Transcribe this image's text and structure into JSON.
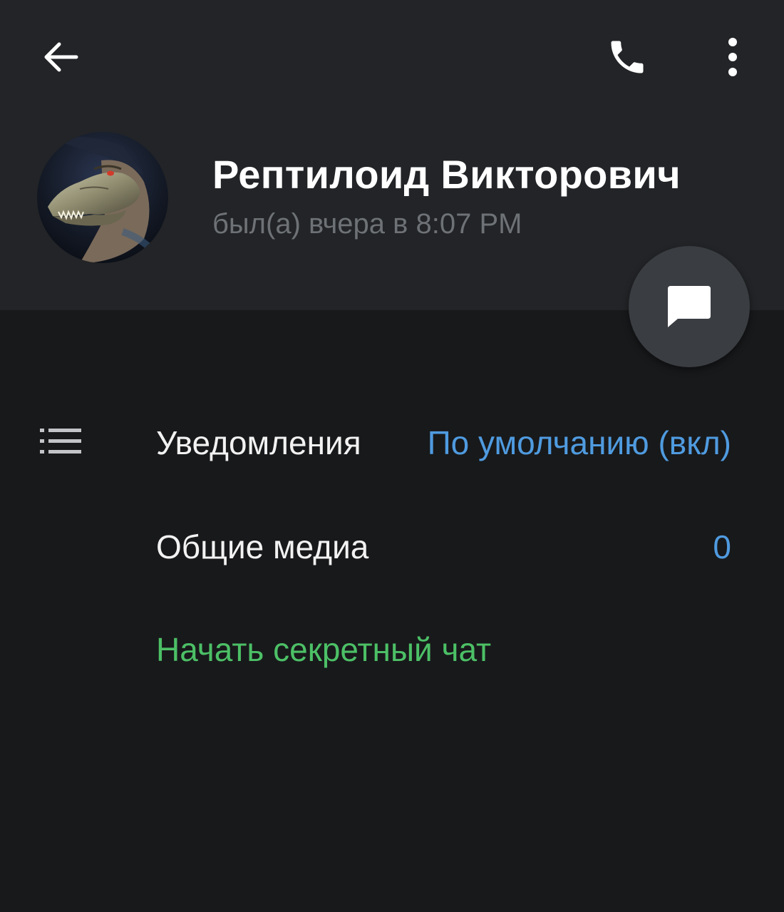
{
  "header": {
    "back_icon": "arrow-left-icon",
    "call_icon": "phone-icon",
    "more_icon": "more-vertical-icon"
  },
  "profile": {
    "name": "Рептилоид Викторович",
    "status": "был(а) вчера в 8:07 PM",
    "avatar": "dinosaur-photo"
  },
  "fab": {
    "icon": "message-icon"
  },
  "rows": {
    "notifications": {
      "icon": "list-icon",
      "label": "Уведомления",
      "value": "По умолчанию (вкл)"
    },
    "shared_media": {
      "label": "Общие медиа",
      "value": "0"
    },
    "secret_chat": {
      "label": "Начать секретный чат"
    }
  },
  "colors": {
    "header_bg": "#222427",
    "page_bg": "#18191b",
    "accent_blue": "#4f9be0",
    "accent_green": "#4cc066",
    "status_gray": "#6e7276"
  }
}
